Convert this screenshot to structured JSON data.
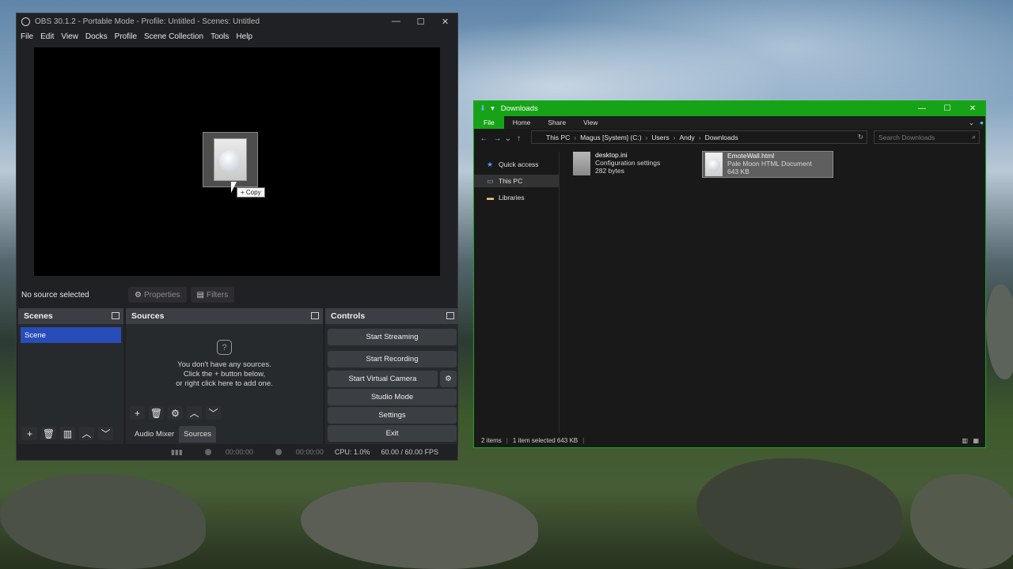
{
  "obs": {
    "title": "OBS 30.1.2 - Portable Mode - Profile: Untitled - Scenes: Untitled",
    "menu": [
      "File",
      "Edit",
      "View",
      "Docks",
      "Profile",
      "Scene Collection",
      "Tools",
      "Help"
    ],
    "drag_tooltip": "+ Copy",
    "no_source": "No source selected",
    "properties": "Properties",
    "filters": "Filters",
    "scenes_title": "Scenes",
    "scene_item": "Scene",
    "sources_title": "Sources",
    "empty_line1": "You don't have any sources.",
    "empty_line2": "Click the + button below,",
    "empty_line3": "or right click here to add one.",
    "tab_audio": "Audio Mixer",
    "tab_sources": "Sources",
    "controls_title": "Controls",
    "controls": {
      "start_streaming": "Start Streaming",
      "start_recording": "Start Recording",
      "start_virtual_camera": "Start Virtual Camera",
      "studio_mode": "Studio Mode",
      "settings": "Settings",
      "exit": "Exit"
    },
    "status": {
      "stream_time": "00:00:00",
      "record_time": "00:00:00",
      "cpu": "CPU: 1.0%",
      "fps": "60.00 / 60.00 FPS"
    }
  },
  "explorer": {
    "title": "Downloads",
    "ribbon": [
      "File",
      "Home",
      "Share",
      "View"
    ],
    "path": [
      "This PC",
      "Magus [System] (C:)",
      "Users",
      "Andy",
      "Downloads"
    ],
    "search_placeholder": "Search Downloads",
    "nav": [
      "Quick access",
      "This PC",
      "Libraries"
    ],
    "files": [
      {
        "name": "desktop.ini",
        "type": "Configuration settings",
        "size": "282 bytes"
      },
      {
        "name": "EmoteWall.html",
        "type": "Pale Moon HTML Document",
        "size": "643 KB"
      }
    ],
    "status_items": "2 items",
    "status_selected": "1 item selected  643 KB"
  },
  "colors": {
    "accent_green": "#17a317",
    "scene_selected": "#284cb8"
  }
}
